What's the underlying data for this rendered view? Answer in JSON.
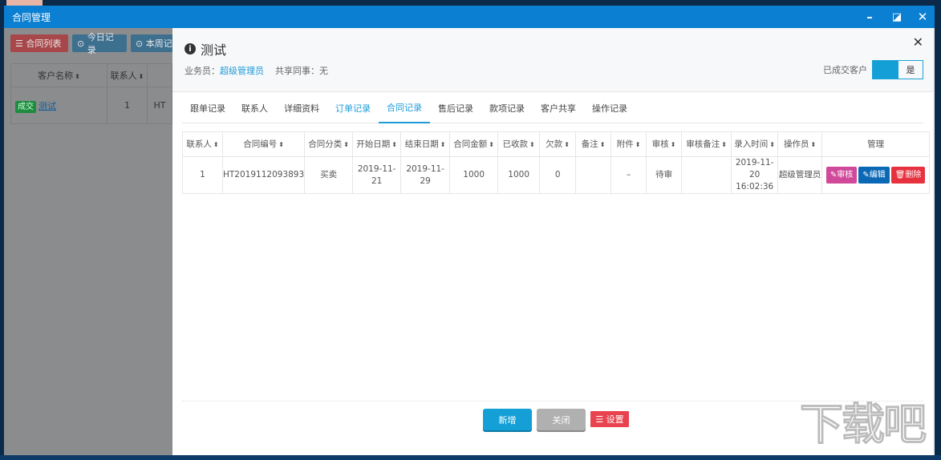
{
  "window": {
    "title": "合同管理",
    "controls": [
      "minimize",
      "maximize",
      "close"
    ]
  },
  "left": {
    "buttons": [
      "合同列表",
      "今日记录",
      "本周记"
    ],
    "headers": [
      "客户名称",
      "联系人"
    ],
    "row": {
      "tag": "成交",
      "name": "测试",
      "contacts": "1",
      "partial": "HT"
    }
  },
  "modal": {
    "title": "测试",
    "salesperson_label": "业务员：",
    "salesperson": "超级管理员",
    "share_label": "共享同事：无",
    "deal_label": "已成交客户",
    "deal_toggle": "是",
    "tabs": [
      {
        "label": "跟单记录"
      },
      {
        "label": "联系人"
      },
      {
        "label": "详细资料"
      },
      {
        "label": "订单记录"
      },
      {
        "label": "合同记录",
        "active": true
      },
      {
        "label": "售后记录"
      },
      {
        "label": "款项记录"
      },
      {
        "label": "客户共享"
      },
      {
        "label": "操作记录"
      }
    ],
    "table": {
      "headers": [
        "联系人",
        "合同编号",
        "合同分类",
        "开始日期",
        "结束日期",
        "合同金额",
        "已收款",
        "欠款",
        "备注",
        "附件",
        "审核",
        "审核备注",
        "录入时间",
        "操作员",
        "管理"
      ],
      "rows": [
        {
          "contact": "1",
          "number": "HT2019112093893",
          "category": "买卖",
          "start": "2019-11-21",
          "end": "2019-11-29",
          "amount": "1000",
          "received": "1000",
          "owed": "0",
          "note": "",
          "attachment": "–",
          "review": "待审",
          "review_note": "",
          "created": "2019-11-20 16:02:36",
          "operator": "超级管理员",
          "actions": [
            "审核",
            "编辑",
            "删除"
          ]
        }
      ]
    },
    "footer": {
      "add": "新增",
      "close": "关闭",
      "settings": "设置"
    }
  },
  "watermark": "下载吧",
  "colors": {
    "titlebar": "#0b7fd1",
    "primary": "#14a0d6",
    "danger": "#e8313f",
    "review": "#d0499a",
    "edit": "#0b68b5"
  }
}
